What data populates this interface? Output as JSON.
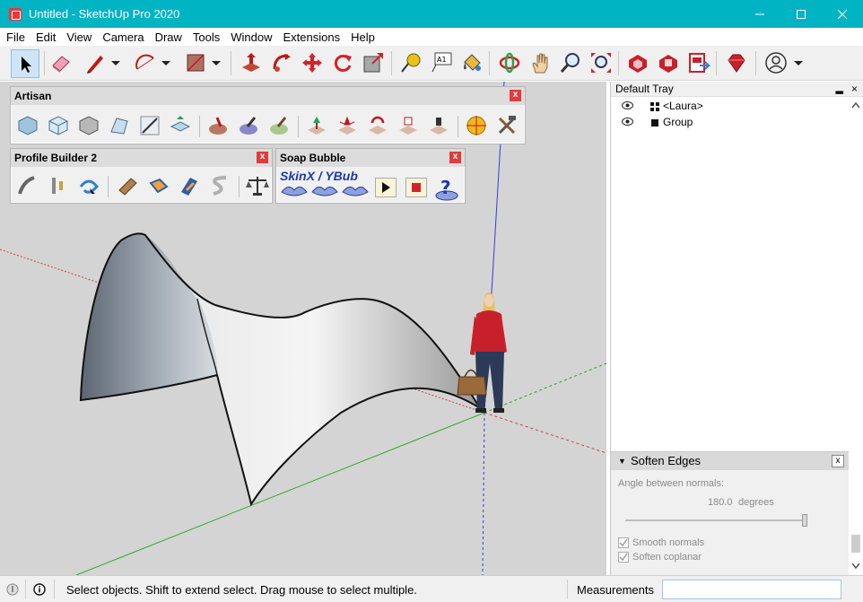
{
  "window": {
    "title": "Untitled - SketchUp Pro 2020",
    "app_icon": "sketchup-logo-icon",
    "buttons": [
      "minimize-icon",
      "maximize-icon",
      "close-icon"
    ]
  },
  "menu": {
    "items": [
      "File",
      "Edit",
      "View",
      "Camera",
      "Draw",
      "Tools",
      "Window",
      "Extensions",
      "Help"
    ]
  },
  "main_toolbar": {
    "icons": [
      "select-icon",
      "eraser-icon",
      "pencil-line-icon",
      "arc-icon",
      "rectangle-icon",
      "push-pull-icon",
      "follow-me-icon",
      "move-icon",
      "rotate-icon",
      "scale-icon",
      "tape-measure-icon",
      "text-icon",
      "paint-bucket-icon",
      "orbit-icon",
      "pan-icon",
      "zoom-icon",
      "zoom-extents-icon",
      "3d-warehouse-icon",
      "extension-warehouse-icon",
      "layout-icon",
      "ruby-icon",
      "account-icon"
    ],
    "text_icon_label": "A1"
  },
  "artisan_toolbar": {
    "title": "Artisan",
    "close": "x"
  },
  "profile_builder_toolbar": {
    "title": "Profile Builder 2",
    "close": "x"
  },
  "soap_bubble_toolbar": {
    "title": "Soap Bubble",
    "label": "SkinX / YBub",
    "close": "x"
  },
  "tray": {
    "title": "Default Tray",
    "pin": "▂",
    "close": "×",
    "outliner": [
      {
        "label": "<Laura>",
        "type": "component"
      },
      {
        "label": "Group",
        "type": "group"
      }
    ],
    "soften_edges": {
      "title": "Soften Edges",
      "angle_label": "Angle between normals:",
      "angle_value": "180.0",
      "angle_unit": "degrees",
      "angle_fraction": 1.0,
      "smooth_normals": "Smooth normals",
      "soften_coplanar": "Soften coplanar",
      "close": "x"
    }
  },
  "status": {
    "hint": "Select objects. Shift to extend select. Drag mouse to select multiple.",
    "measurements_label": "Measurements",
    "measurements_value": ""
  },
  "colors": {
    "titlebar": "#00b4c4",
    "viewport": "#d4d4d4",
    "axis_red": "#d04040",
    "axis_green": "#2fa52f",
    "axis_blue": "#3a3ad8"
  }
}
